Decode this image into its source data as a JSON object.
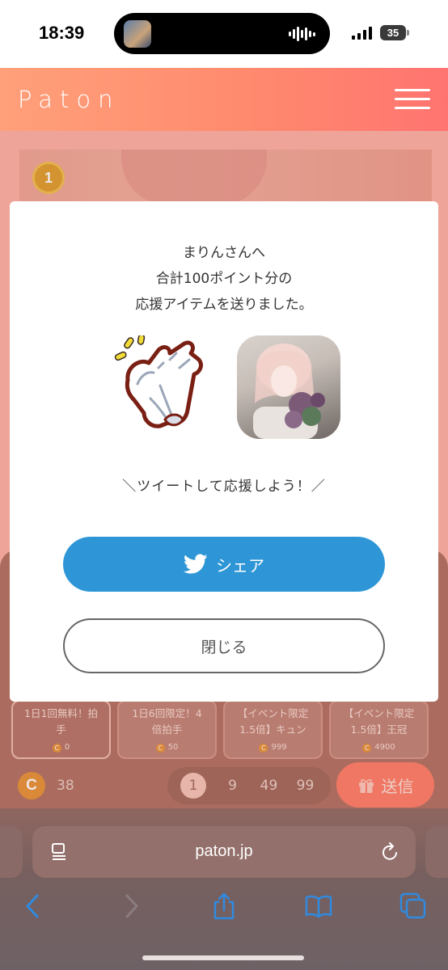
{
  "status_bar": {
    "time": "18:39",
    "battery": "35"
  },
  "header": {
    "logo": "Paton",
    "menu_icon": "hamburger-icon"
  },
  "modal": {
    "message_line1": "まりんさんへ",
    "message_line2": "合計100ポイント分の",
    "message_line3": "応援アイテムを送りました。",
    "tweet_prompt": "＼ツイートして応援しよう！／",
    "share_label": "シェア",
    "close_label": "閉じる"
  },
  "items": [
    {
      "name_line1": "1日1回無料！拍",
      "name_line2": "手",
      "price": "0"
    },
    {
      "name_line1": "1日6回限定！4",
      "name_line2": "倍拍手",
      "price": "50"
    },
    {
      "name_line1": "【イベント限定",
      "name_line2": "1.5倍】キュン",
      "price": "999"
    },
    {
      "name_line1": "【イベント限定",
      "name_line2": "1.5倍】王冠",
      "price": "4900"
    }
  ],
  "coins": {
    "symbol": "C",
    "balance": "38"
  },
  "quantity_options": [
    "1",
    "9",
    "49",
    "99"
  ],
  "send_label": "送信",
  "rank": "1",
  "browser": {
    "url": "paton.jp"
  },
  "colors": {
    "brand_start": "#ffa07a",
    "brand_end": "#ff7470",
    "share_blue": "#2e96d6",
    "coin": "#e8953a"
  }
}
